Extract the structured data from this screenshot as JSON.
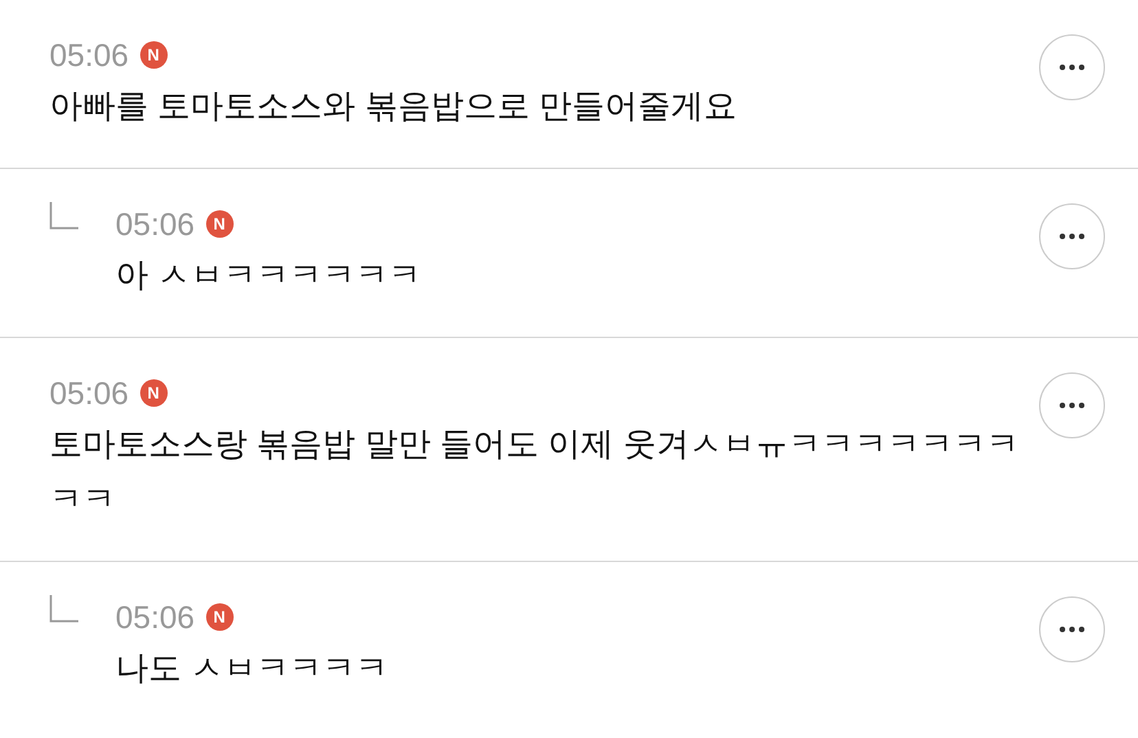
{
  "comments": [
    {
      "kind": "comment",
      "time": "05:06",
      "badge": "N",
      "text": "아빠를 토마토소스와 볶음밥으로 만들어줄게요"
    },
    {
      "kind": "reply",
      "time": "05:06",
      "badge": "N",
      "text": "아 ㅅㅂㅋㅋㅋㅋㅋㅋ"
    },
    {
      "kind": "comment",
      "time": "05:06",
      "badge": "N",
      "text": "토마토소스랑 볶음밥 말만 들어도 이제 웃겨ㅅㅂㅠㅋㅋㅋㅋㅋㅋㅋㅋㅋ"
    },
    {
      "kind": "reply",
      "time": "05:06",
      "badge": "N",
      "text": "나도 ㅅㅂㅋㅋㅋㅋ"
    }
  ]
}
